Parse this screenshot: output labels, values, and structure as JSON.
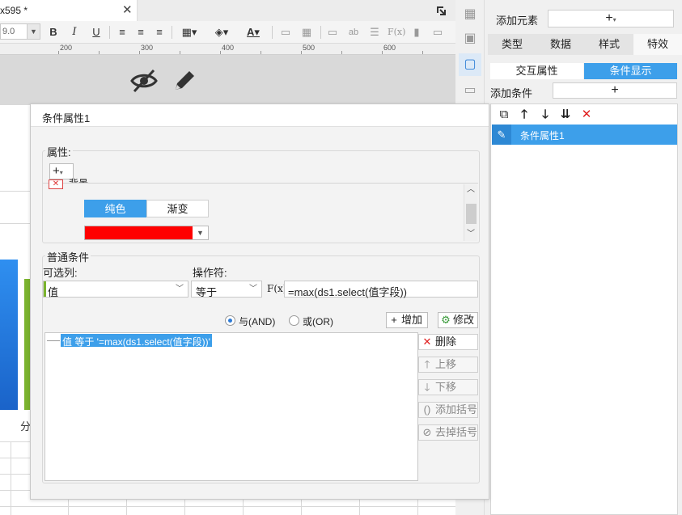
{
  "editor": {
    "file_tab_label": "x595 *",
    "font_size": "9.0",
    "ruler_labels": [
      "200",
      "300",
      "400",
      "500",
      "600"
    ],
    "sheet_partial_text": "分"
  },
  "right_panel": {
    "add_element_label": "添加元素",
    "add_element_button": "+",
    "tabs": [
      "类型",
      "数据",
      "样式",
      "特效"
    ],
    "active_tab": "特效",
    "subtabs": [
      "交互属性",
      "条件显示"
    ],
    "active_subtab": "条件显示",
    "add_condition_label": "添加条件",
    "add_condition_button": "+",
    "condition_items": [
      "条件属性1"
    ]
  },
  "dialog": {
    "title": "条件属性1",
    "property_group_label": "属性:",
    "property_add_button": "+",
    "background_label": "背景",
    "fill_options": [
      "纯色",
      "渐变"
    ],
    "fill_selected": "纯色",
    "color_value": "#ff0000",
    "condition_group_label": "普通条件",
    "column_label": "可选列:",
    "column_value": "值",
    "operator_label": "操作符:",
    "operator_value": "等于",
    "fx_label": "F(x)",
    "formula_value": "=max(ds1.select(值字段))",
    "radio_and": "与(AND)",
    "radio_or": "或(OR)",
    "radio_selected": "AND",
    "add_button": "增加",
    "modify_button": "修改",
    "condition_line": "值 等于 '=max(ds1.select(值字段))'",
    "delete_button": "删除",
    "move_up_button": "上移",
    "move_down_button": "下移",
    "add_bracket_button": "添加括号",
    "remove_bracket_button": "去掉括号"
  },
  "colors": {
    "accent_blue": "#3d9fea",
    "red_fill": "#ff0000",
    "chart_blue": "#1a63c9",
    "chart_green": "#7bb32e"
  }
}
